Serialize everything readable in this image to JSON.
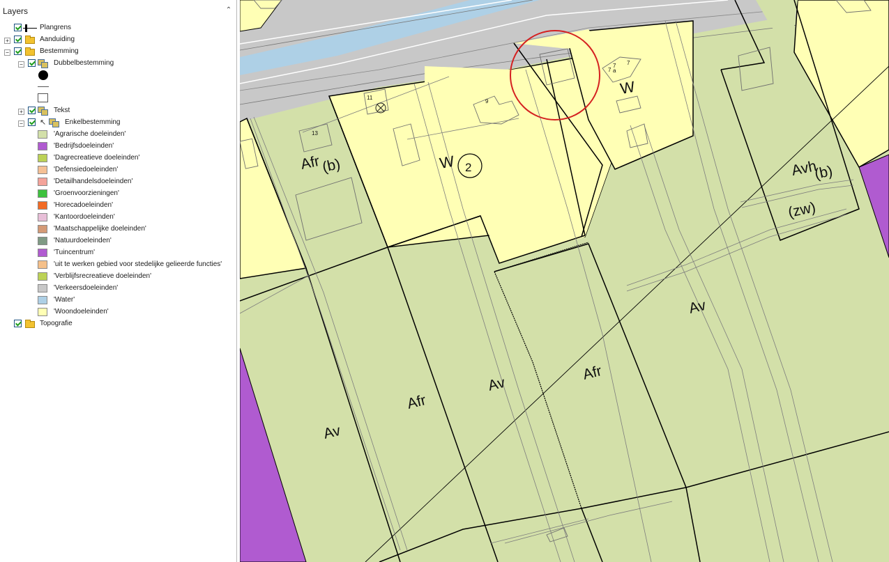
{
  "panel": {
    "title": "Layers"
  },
  "layers": {
    "plangrens": "Plangrens",
    "aanduiding": "Aanduiding",
    "bestemming": "Bestemming",
    "dubbelbestemming": "Dubbelbestemming",
    "tekst": "Tekst",
    "enkelbestemming": "Enkelbestemming",
    "topografie": "Topografie"
  },
  "legend": [
    {
      "label": "'Agrarische doeleinden'",
      "color": "#d3e0a9"
    },
    {
      "label": "'Bedrijfsdoeleinden'",
      "color": "#b05bd0"
    },
    {
      "label": "'Dagrecreatieve doeleinden'",
      "color": "#bcd256"
    },
    {
      "label": "'Defensiedoeleinden'",
      "color": "#f5c095"
    },
    {
      "label": "'Detailhandelsdoeleinden'",
      "color": "#f4a39a"
    },
    {
      "label": "'Groenvoorzieningen'",
      "color": "#3ec23e"
    },
    {
      "label": "'Horecadoeleinden'",
      "color": "#f26a24"
    },
    {
      "label": "'Kantoordoeleinden'",
      "color": "#e8bfd8"
    },
    {
      "label": "'Maatschappelijke doeleinden'",
      "color": "#d49a76"
    },
    {
      "label": "'Natuurdoeleinden'",
      "color": "#7f9a84"
    },
    {
      "label": "'Tuincentrum'",
      "color": "#b05bd0"
    },
    {
      "label": "'uit te werken gebied voor stedelijke gelieerde functies'",
      "color": "#f5c08a"
    },
    {
      "label": "'Verblijfsrecreatieve doeleinden'",
      "color": "#bcd256"
    },
    {
      "label": "'Verkeersdoeleinden'",
      "color": "#c8c8c8"
    },
    {
      "label": "'Water'",
      "color": "#aed0e6"
    },
    {
      "label": "'Woondoeleinden'",
      "color": "#ffffb5"
    }
  ],
  "map": {
    "colors": {
      "agrarisch": "#d3e0a9",
      "woon": "#ffffb5",
      "verkeer": "#c8c8c8",
      "water": "#aed0e6",
      "bedrijf": "#b05bd0",
      "highlight": "#d42020"
    },
    "labels": {
      "w_center": "W",
      "w_east": "W",
      "afr_b_afr": "Afr",
      "afr_b_b": "(b)",
      "avh": "Avh",
      "avh_b": "(b)",
      "avh_zw": "(zw)",
      "av_1": "Av",
      "av_2": "Av",
      "av_3": "Av",
      "afr_1": "Afr",
      "afr_2": "Afr",
      "circle_2": "2",
      "house_9": "9",
      "house_13": "13",
      "house_7": "7",
      "house_7a_1": "7",
      "house_7a_2": "7",
      "house_7a_3": "a",
      "house_11": "11"
    }
  }
}
